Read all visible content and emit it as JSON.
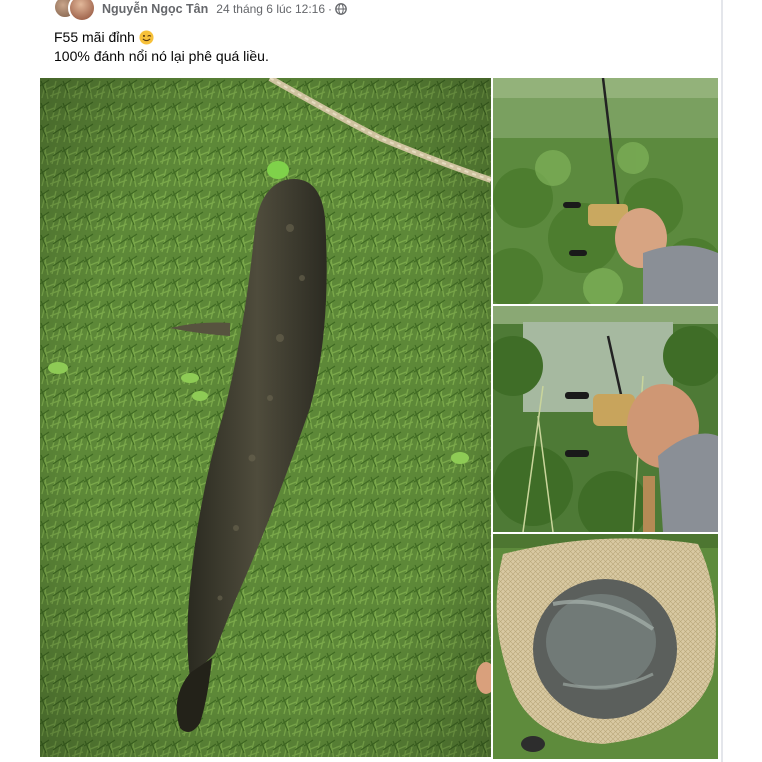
{
  "post": {
    "author": "Nguyễn Ngọc Tân",
    "timestamp": "24 tháng 6 lúc 12:16",
    "separator": "·",
    "privacy_icon": "globe-icon",
    "text_line1": "F55 mãi đỉnh",
    "text_line1_emoji": "wink-emoji",
    "text_line2": "100% đánh nổi nó lại phê quá liều."
  },
  "photos": [
    {
      "subject": "snakehead-fish-on-grass"
    },
    {
      "subject": "fishing-rod-over-pond"
    },
    {
      "subject": "baitcasting-reel-in-hand"
    },
    {
      "subject": "fish-in-landing-net"
    }
  ],
  "colors": {
    "text_primary": "#050505",
    "text_secondary": "#65676b",
    "grass": "#5f8a3a",
    "divider": "#e4e6eb"
  }
}
